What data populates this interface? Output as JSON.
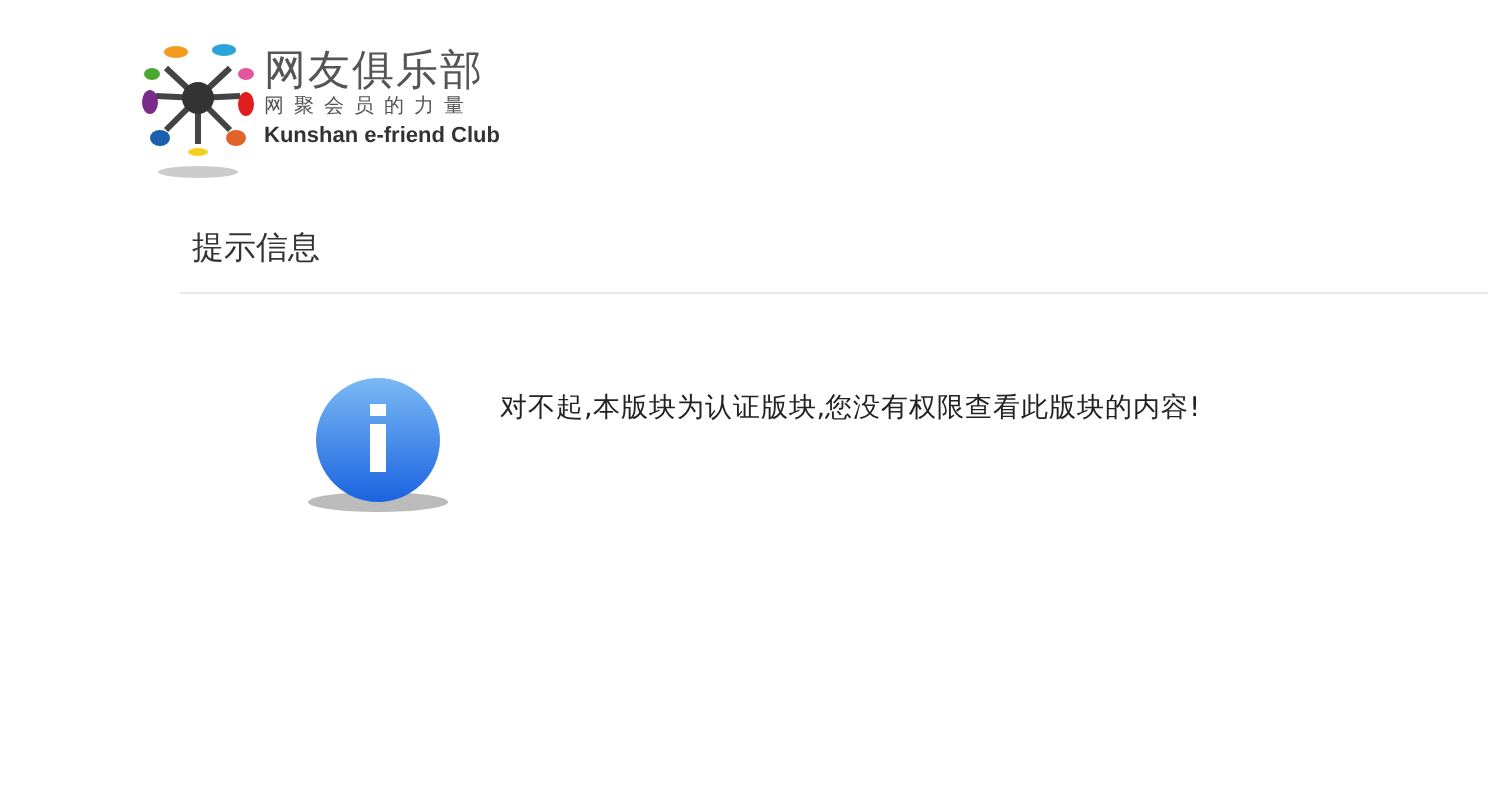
{
  "logo": {
    "title": "网友俱乐部",
    "slogan": "网聚会员的力量",
    "english": "Kunshan e-friend Club"
  },
  "notice": {
    "heading": "提示信息",
    "message": "对不起,本版块为认证版块,您没有权限查看此版块的内容!"
  }
}
